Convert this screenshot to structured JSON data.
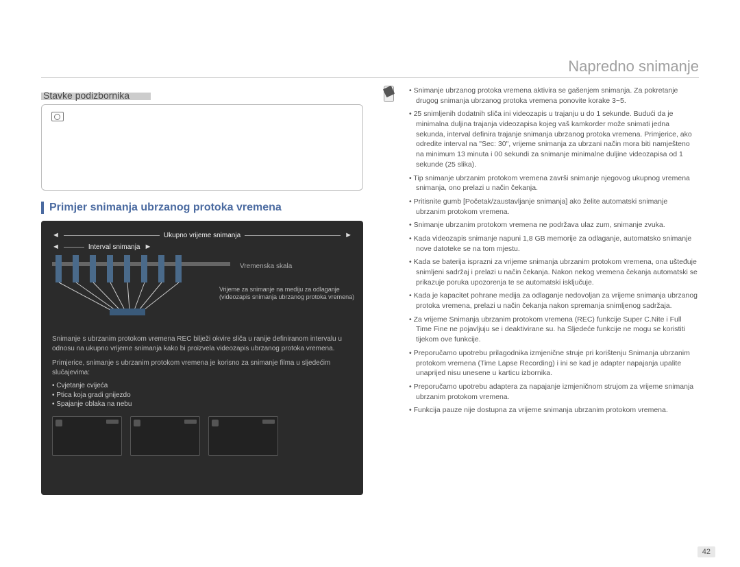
{
  "header": {
    "title": "Napredno snimanje"
  },
  "left": {
    "sub_title": "Stavke podizbornika",
    "box_text": "",
    "section_title": "Primjer snimanja ubrzanog protoka vremena",
    "diagram": {
      "total_time": "Ukupno vrijeme snimanja",
      "interval": "Interval snimanja",
      "timeline_label": "Vremenska skala",
      "record_label": "Vrijeme za snimanje na mediju za odlaganje (videozapis snimanja ubrzanog protoka vremena)",
      "desc1": "Snimanje s ubrzanim protokom vremena REC bilježi okvire sliča u ranije definiranom intervalu u odnosu na ukupno vrijeme snimanja kako bi proizvela videozapis ubrzanog protoka vremena.",
      "desc2": "Primjerice, snimanje s ubrzanim protokom vremena je korisno za snimanje filma u sljedećim slučajevima:",
      "bullets": [
        "Cvjetanje cvijeća",
        "Ptica koja gradi gnijezdo",
        "Spajanje oblaka na nebu"
      ]
    }
  },
  "right": {
    "notes": [
      "Snimanje ubrzanog protoka vremena aktivira se gašenjem snimanja. Za pokretanje drugog snimanja ubrzanog protoka vremena ponovite korake 3~5.",
      "25 snimljenih dodatnih sliča ini videozapis u trajanju u do 1 sekunde. Budući da je minimalna duljina trajanja videozapisa kojeg vaš kamkorder može snimati jedna sekunda, interval definira trajanje snimanja ubrzanog protoka vremena. Primjerice, ako odredite interval na \"Sec: 30\", vrijeme snimanja za ubrzani način mora biti namješteno na minimum 13 minuta i 00 sekundi za snimanje minimalne duljine videozapisa od 1 sekunde (25 slika).",
      "Tip snimanje ubrzanim protokom vremena završi snimanje njegovog ukupnog vremena snimanja, ono prelazi u način čekanja.",
      "Pritisnite gumb [Početak/zaustavljanje snimanja] ako želite automatski snimanje ubrzanim protokom vremena.",
      "Snimanje ubrzanim protokom vremena ne podržava ulaz zum, snimanje zvuka.",
      "Kada videozapis snimanje napuni 1,8 GB memorije za odlaganje, automatsko snimanje nove datoteke se na tom mjestu.",
      "Kada se baterija isprazni za vrijeme snimanja ubrzanim protokom vremena, ona ušteđuje snimljeni sadržaj i prelazi u način čekanja. Nakon nekog vremena čekanja automatski se prikazuje poruka upozorenja te se automatski isključuje.",
      "Kada je kapacitet pohrane medija za odlaganje nedovoljan za vrijeme snimanja ubrzanog protoka vremena, prelazi u način čekanja nakon spremanja snimljenog sadržaja.",
      "Za vrijeme Snimanja ubrzanim protokom vremena (REC) funkcije Super C.Nite i Full Time Fine ne pojavljuju se i deaktivirane su. ha Sljedeće funkcije ne mogu se koristiti tijekom ove funkcije.",
      "Preporučamo upotrebu prilagodnika izmjenične struje pri korištenju Snimanja ubrzanim protokom vremena (Time Lapse Recording) i ini se kad je adapter napajanja upalite unaprijed nisu unesene u karticu izbornika.",
      "Preporučamo upotrebu adaptera za napajanje izmjeničnom strujom za vrijeme snimanja ubrzanim protokom vremena.",
      "Funkcija pauze nije dostupna za vrijeme snimanja ubrzanim protokom vremena."
    ]
  },
  "page_number": "42"
}
